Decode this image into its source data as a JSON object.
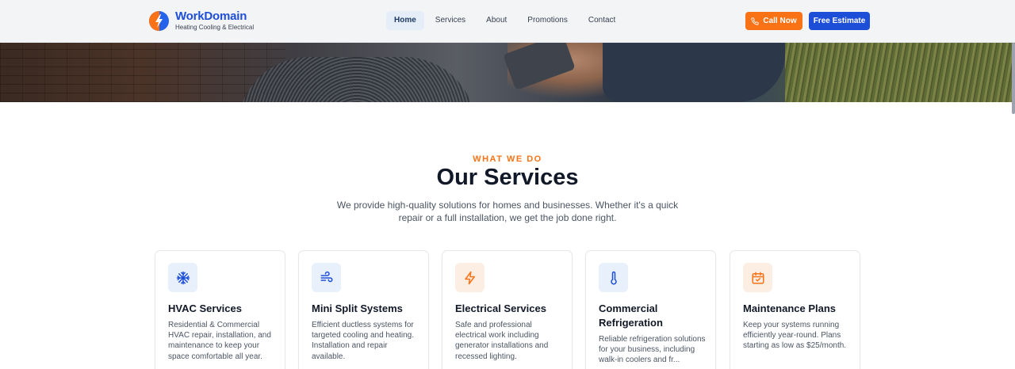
{
  "brand": {
    "name": "WorkDomain",
    "tagline": "Heating Cooling & Electrical",
    "colors": {
      "primary": "#1d4ed8",
      "accent": "#f97316"
    }
  },
  "nav": {
    "items": [
      {
        "label": "Home",
        "active": true
      },
      {
        "label": "Services"
      },
      {
        "label": "About"
      },
      {
        "label": "Promotions"
      },
      {
        "label": "Contact"
      }
    ]
  },
  "header_actions": {
    "call_label": "Call Now",
    "call_icon": "phone-icon",
    "estimate_label": "Free Estimate"
  },
  "services_section": {
    "eyebrow": "WHAT WE DO",
    "title": "Our Services",
    "subtitle": "We provide high-quality solutions for homes and businesses. Whether it's a quick repair or a full installation, we get the job done right.",
    "cards": [
      {
        "icon": "snowflake-icon",
        "title": "HVAC Services",
        "description": "Residential & Commercial HVAC repair, installation, and maintenance to keep your space comfortable all year."
      },
      {
        "icon": "wind-icon",
        "title": "Mini Split Systems",
        "description": "Efficient ductless systems for targeted cooling and heating. Installation and repair available."
      },
      {
        "icon": "lightning-icon",
        "title": "Electrical Services",
        "description": "Safe and professional electrical work including generator installations and recessed lighting."
      },
      {
        "icon": "thermometer-icon",
        "title": "Commercial Refrigeration",
        "description": "Reliable refrigeration solutions for your business, including walk-in coolers and fr..."
      },
      {
        "icon": "calendar-check-icon",
        "title": "Maintenance Plans",
        "description": "Keep your systems running efficiently year-round. Plans starting as low as $25/month."
      }
    ]
  }
}
